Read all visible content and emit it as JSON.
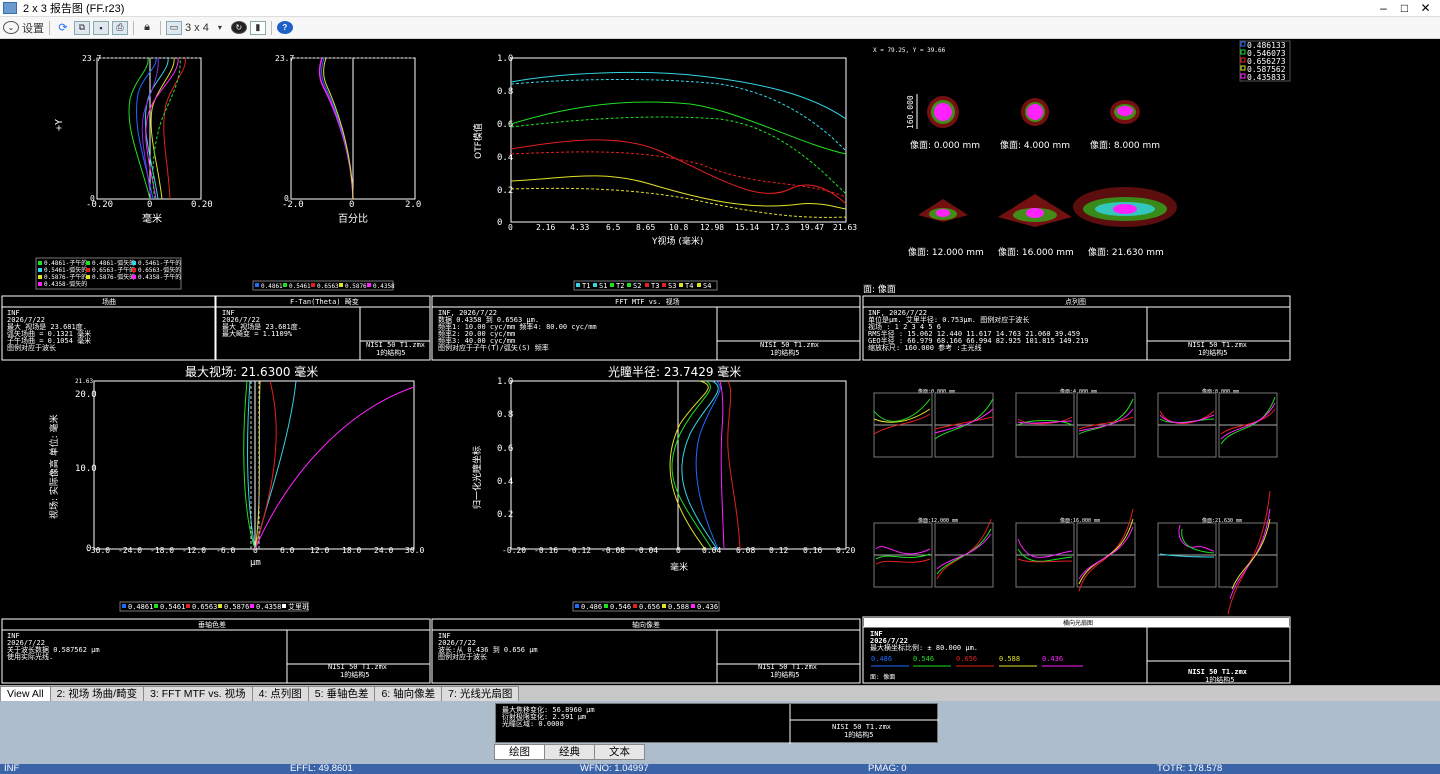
{
  "window": {
    "title": "2 x 3 报告图 (FF.r23)",
    "min": "–",
    "max": "□",
    "close": "✕"
  },
  "toolbar": {
    "settings": "设置",
    "layout": "3 x 4"
  },
  "colors": {
    "blue": "#1e6cff",
    "cyan": "#33d6e6",
    "green": "#21e021",
    "red": "#e52020",
    "yellow": "#e1e128",
    "magenta": "#ff22ff",
    "purple": "#8a2be2",
    "orange": "#ffa500"
  },
  "field_curv": {
    "y_top": "23.7",
    "zero": "0",
    "y_axis": "+Y",
    "x_ticks": [
      "-0.20",
      "0",
      "0.20"
    ],
    "x_label": "毫米",
    "legend": [
      "0.4861-子午的",
      "0.4861-弧矢的",
      "0.5461-子午的",
      "0.5461-弧矢的",
      "0.6563-子午的",
      "0.6563-弧矢的",
      "0.5876-子午的",
      "0.5876-弧矢的",
      "0.4358-子午的",
      "0.4358-弧矢的"
    ]
  },
  "distortion": {
    "y_top": "23.7",
    "zero": "0",
    "x_ticks": [
      "-2.0",
      "0",
      "2.0"
    ],
    "x_label": "百分比",
    "legend": [
      "0.4861",
      "0.5461",
      "0.6563",
      "0.5876",
      "0.4358"
    ]
  },
  "mtf": {
    "y_ticks": [
      "0",
      "0.2",
      "0.4",
      "0.6",
      "0.8",
      "1.0"
    ],
    "x_ticks": [
      "0",
      "2.16",
      "4.33",
      "6.5",
      "8.65",
      "10.8",
      "12.98",
      "15.14",
      "17.3",
      "19.47",
      "21.63"
    ],
    "y_label": "OTF模值",
    "x_label": "Y视场 (毫米)",
    "legend": [
      "T1",
      "S1",
      "T2",
      "S2",
      "T3",
      "S3",
      "T4",
      "S4"
    ]
  },
  "spot": {
    "coord": "X = 79.25, Y = 39.66",
    "scale": "160.000",
    "surface": "面: 像面",
    "labels": [
      "像面: 0.000 mm",
      "像面: 4.000 mm",
      "像面: 8.000 mm",
      "像面: 12.000 mm",
      "像面: 16.000 mm",
      "像面: 21.630 mm"
    ],
    "legend": [
      "0.486133",
      "0.546073",
      "0.656273",
      "0.587562",
      "0.435833"
    ]
  },
  "info_fc": {
    "title": "场曲",
    "lines": [
      "INF",
      "2026/7/22",
      "最大 视场是 23.681度.",
      "弧矢场曲 = 0.1321 毫米",
      "子午场曲 = 0.1054 毫米",
      "图例对应于波长"
    ]
  },
  "info_dist": {
    "title": "F-Tan(Theta) 畸变",
    "lines": [
      "INF",
      "2026/7/22",
      "最大 视场是 23.681度.",
      "最大畸变 = 1.1109%"
    ],
    "file": "NISI 50 T1.zmx",
    "config": "1的结构5"
  },
  "info_mtf": {
    "title": "FFT MTF vs. 视场",
    "lines": [
      "INF, 2026/7/22",
      "数据 0.4358 到 0.6563 μm.",
      "频率1:   10.00 cyc/mm 频率4:   80.00 cyc/mm",
      "频率2:   20.00 cyc/mm",
      "频率3:   40.00 cyc/mm",
      "图例对应于子午(T)/弧矢(S) 频率"
    ],
    "file": "NISI 50 T1.zmx",
    "config": "1的结构5"
  },
  "info_spot": {
    "title": "点列图",
    "lines": [
      "INF, 2026/7/22",
      "单位是μm.          艾里半径: 0.753μm. 图例对应于波长",
      "视场      :    1       2       3       4       5       6",
      "RMS半径 :   15.062   12.440   11.617   14.763   21.060   39.459",
      "GEO半径 :   66.979   68.166   66.994   82.925  101.815  149.219",
      "缩放标尺:   160.000      参考  :主光线"
    ],
    "file": "NISI 50 T1.zmx",
    "config": "1的结构5"
  },
  "lat_color": {
    "title": "最大视场: 21.6300 毫米",
    "y_top": "21.63",
    "y_ticks": [
      "20.0",
      "10.0",
      "0"
    ],
    "x_ticks": [
      "-30.0",
      "-24.0",
      "-18.0",
      "-12.0",
      "-6.0",
      "0",
      "6.0",
      "12.0",
      "18.0",
      "24.0",
      "30.0"
    ],
    "x_label": "μm",
    "y_label": "视场: 实际像高 单位: 毫米",
    "legend": [
      "0.4861",
      "0.5461",
      "0.6563",
      "0.5876",
      "0.4358",
      "艾里斑"
    ]
  },
  "long_ab": {
    "title": "光瞳半径: 23.7429 毫米",
    "y_ticks": [
      "1.0",
      "0.8",
      "0.6",
      "0.4",
      "0.2"
    ],
    "x_ticks": [
      "-0.20",
      "-0.16",
      "-0.12",
      "-0.08",
      "-0.04",
      "0",
      "0.04",
      "0.08",
      "0.12",
      "0.16",
      "0.20"
    ],
    "x_label": "毫米",
    "y_label": "归一化光瞳坐标",
    "legend": [
      "0.486",
      "0.546",
      "0.656",
      "0.588",
      "0.436"
    ]
  },
  "ray_fan": {
    "labels": [
      "像面:0.000 mm",
      "像面:4.000 mm",
      "像面:8.000 mm",
      "像面:12.000 mm",
      "像面:16.000 mm",
      "像面:21.630 mm"
    ],
    "ey": "ey",
    "ex": "ex",
    "py": "py",
    "px": "px"
  },
  "info_lat": {
    "title": "垂轴色差",
    "lines": [
      "INF",
      "2026/7/22",
      "关于波长数据 0.587562 μm",
      "使用实际光线."
    ],
    "file": "NISI 50 T1.zmx",
    "config": "1的结构5"
  },
  "info_long": {
    "title": "轴向像差",
    "lines": [
      "INF",
      "2026/7/22",
      "波长:从 0.436 到 0.656 μm",
      "图例对应于波长"
    ],
    "file": "NISI 50 T1.zmx",
    "config": "1的结构5"
  },
  "info_fan": {
    "title": "横向光扇图",
    "lines": [
      "INF",
      "2026/7/22",
      "最大横坐标比例: ± 80.000 μm."
    ],
    "wl": [
      "0.486",
      "0.546",
      "0.656",
      "0.588",
      "0.436"
    ],
    "surface": "面: 像面",
    "file": "NISI 50 T1.zmx",
    "config": "1的结构5"
  },
  "tabs": [
    "View All",
    "2: 视场 场曲/畸变",
    "3: FFT MTF vs. 视场",
    "4: 点列图",
    "5: 垂轴色差",
    "6: 轴向像差",
    "7: 光线光扇图"
  ],
  "lower": {
    "lines": [
      "最大焦移变化: 56.8960 μm",
      "衍射极限变化: 2.591 μm",
      "光瞳区域: 0.0000"
    ],
    "file": "NISI 50 T1.zmx",
    "config": "1的结构5",
    "tabs": [
      "绘图",
      "经典",
      "文本"
    ]
  },
  "status": {
    "left": "INF",
    "effl": "EFFL: 49.8601",
    "wfno": "WFNO: 1.04997",
    "pmag": "PMAG: 0",
    "totr": "TOTR: 178.578"
  }
}
